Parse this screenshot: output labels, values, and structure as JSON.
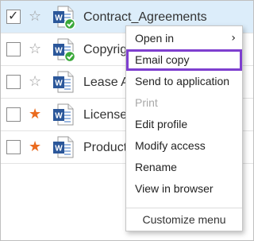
{
  "files": [
    {
      "name": "Contract_Agreements",
      "checked": true,
      "favorite": false,
      "synced": true
    },
    {
      "name": "Copyright",
      "checked": false,
      "favorite": false,
      "synced": true
    },
    {
      "name": "Lease Agreement",
      "checked": false,
      "favorite": false,
      "synced": false
    },
    {
      "name": "Licenses",
      "checked": false,
      "favorite": true,
      "synced": false
    },
    {
      "name": "Products",
      "checked": false,
      "favorite": true,
      "synced": false
    }
  ],
  "check_glyph": "✓",
  "context_menu": {
    "items": [
      {
        "label": "Open in",
        "submenu": true,
        "chevron": "›"
      },
      {
        "label": "Email copy",
        "highlighted": true
      },
      {
        "label": "Send to application"
      },
      {
        "label": "Print",
        "disabled": true
      },
      {
        "label": "Edit profile"
      },
      {
        "label": "Modify access"
      },
      {
        "label": "Rename"
      },
      {
        "label": "View in browser"
      }
    ],
    "footer": "Customize menu"
  },
  "colors": {
    "selected_row": "#dcedfa",
    "favorite_star": "#ea6b1f",
    "empty_star": "#9b9b9b",
    "word_blue": "#2b579a",
    "sync_green": "#3aa83a",
    "highlight_outline": "#7e3fcf"
  }
}
